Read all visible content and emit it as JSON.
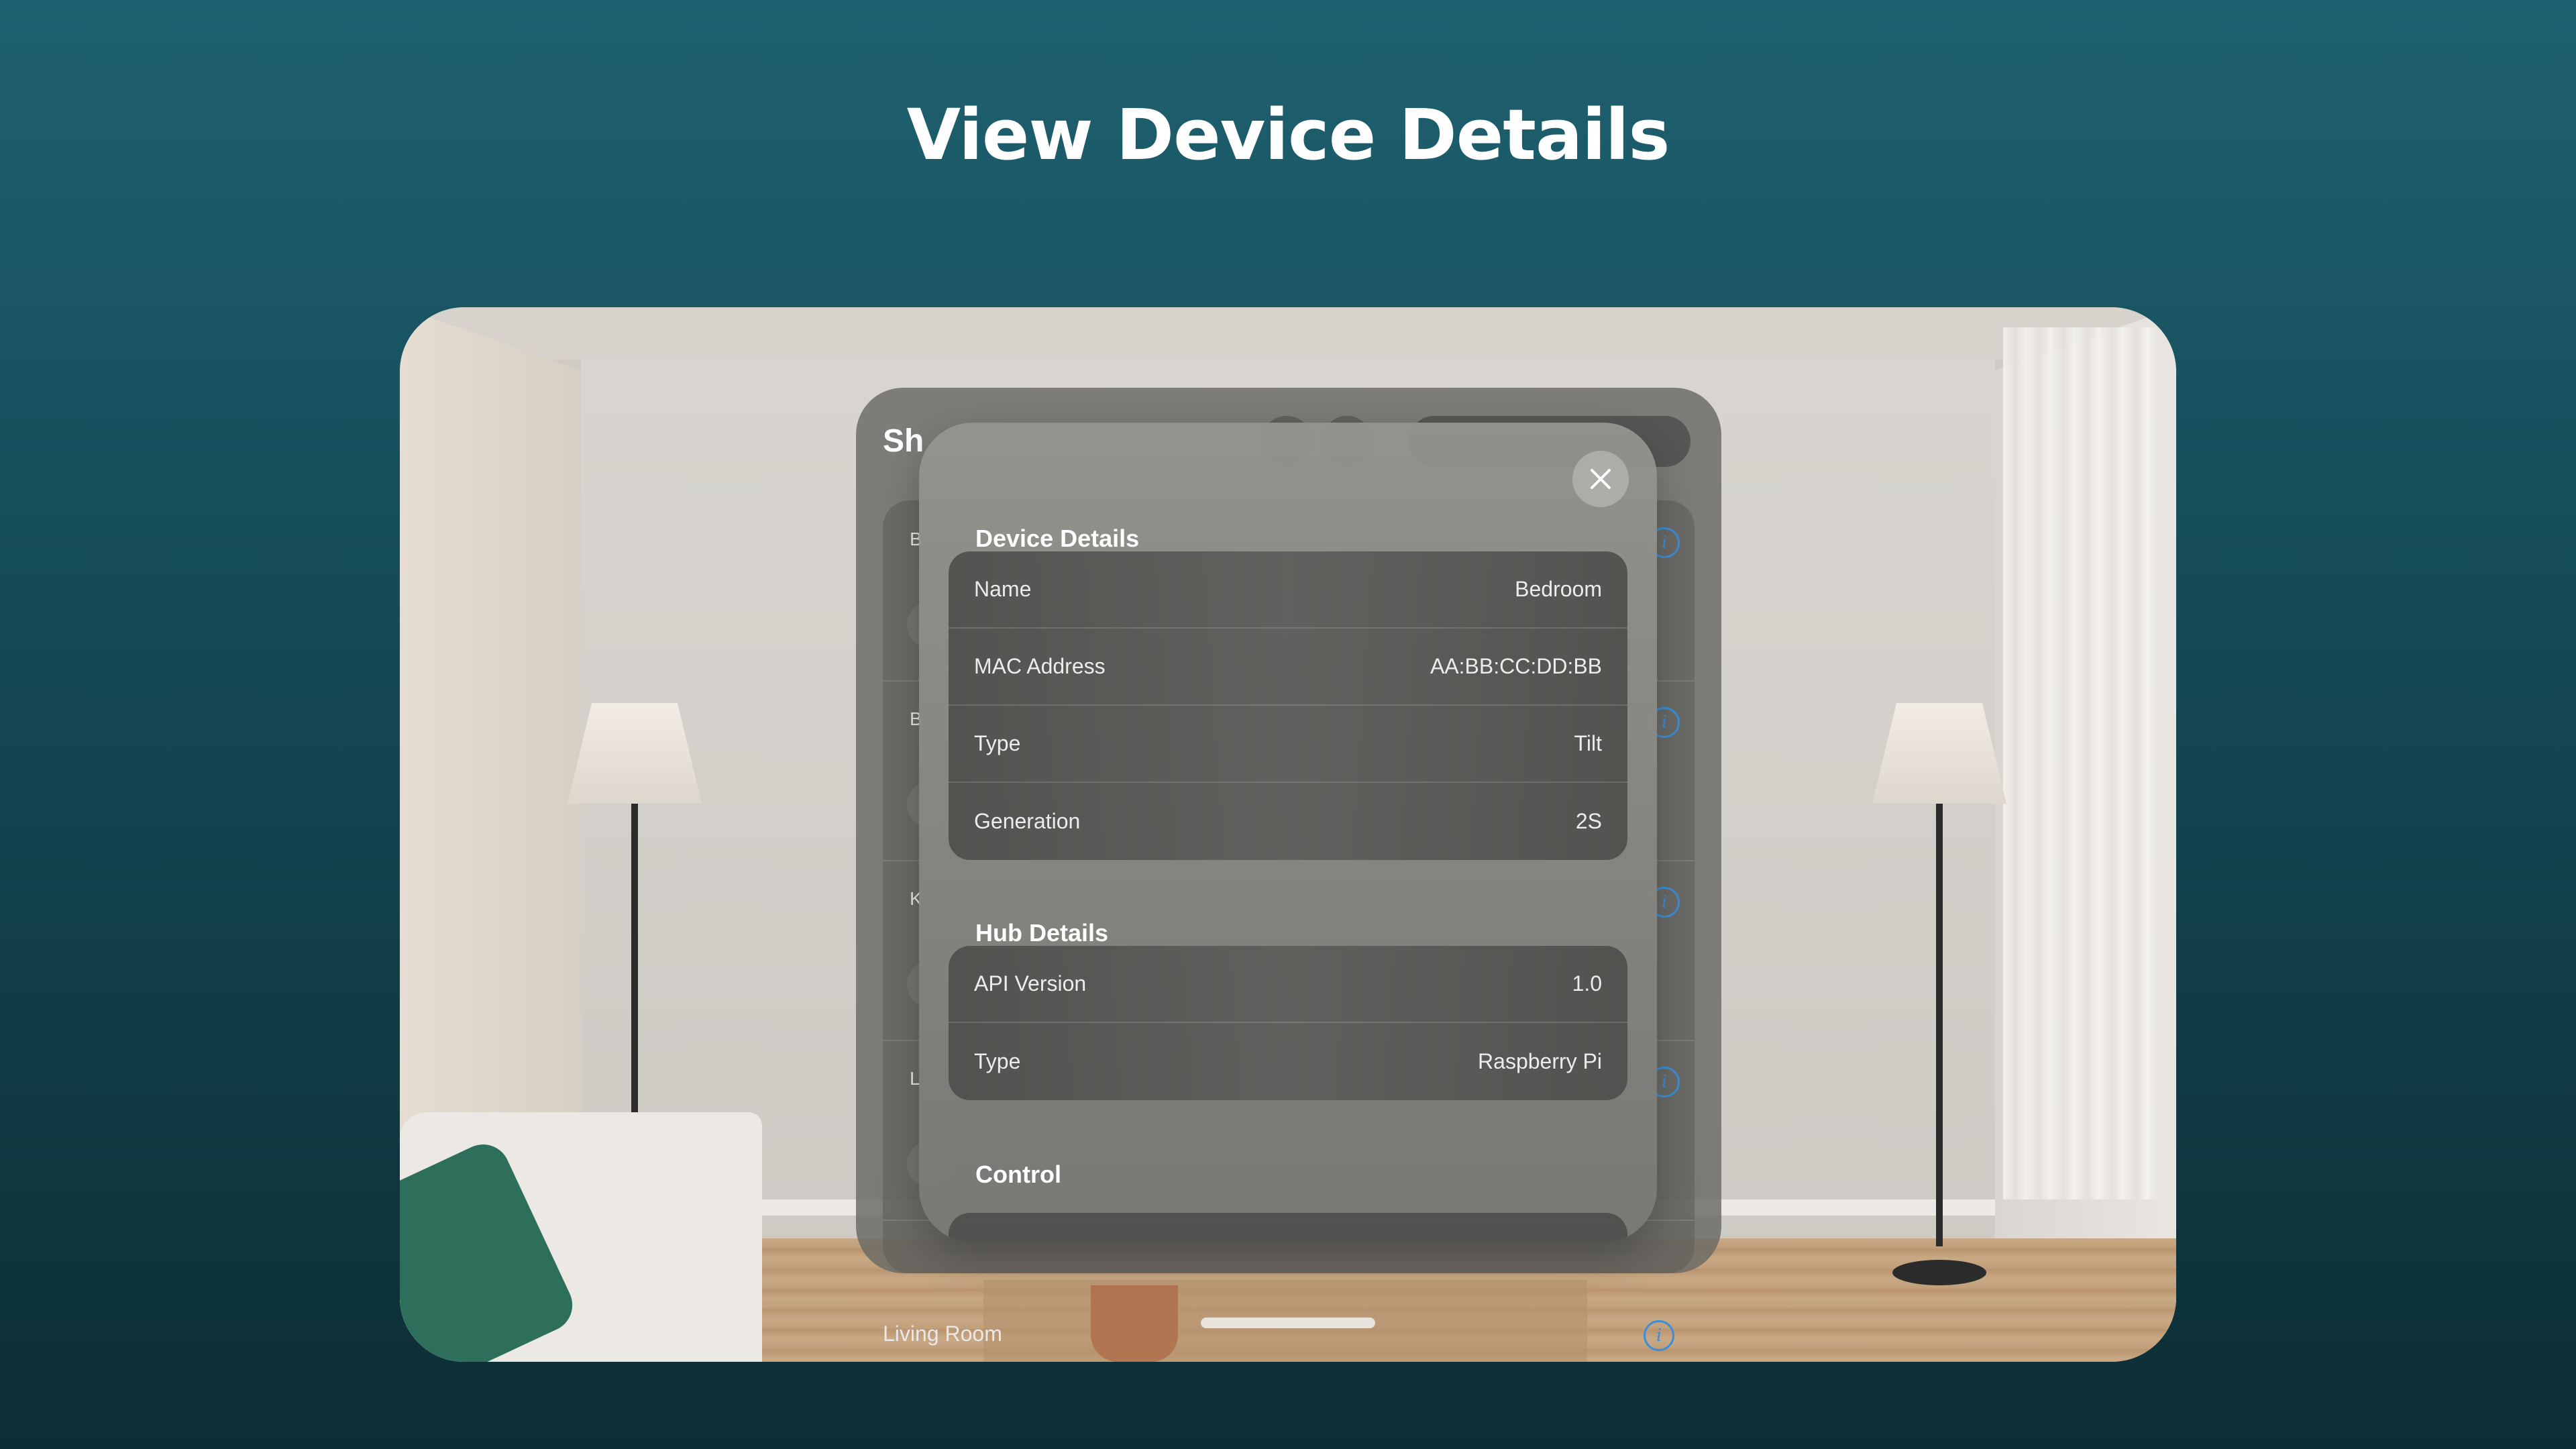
{
  "page": {
    "headline": "View Device Details"
  },
  "background_window": {
    "title": "Sh",
    "row_letters": [
      "B",
      "B",
      "K",
      "L"
    ],
    "bottom_label": "Living Room"
  },
  "modal": {
    "close_icon": "close-icon",
    "device_details": {
      "title": "Device Details",
      "rows": [
        {
          "label": "Name",
          "value": "Bedroom"
        },
        {
          "label": "MAC Address",
          "value": "AA:BB:CC:DD:BB"
        },
        {
          "label": "Type",
          "value": "Tilt"
        },
        {
          "label": "Generation",
          "value": "2S"
        }
      ]
    },
    "hub_details": {
      "title": "Hub Details",
      "rows": [
        {
          "label": "API Version",
          "value": "1.0"
        },
        {
          "label": "Type",
          "value": "Raspberry Pi"
        }
      ]
    },
    "control": {
      "title": "Control"
    }
  },
  "colors": {
    "background_top": "#1f6170",
    "background_bottom": "#0d2d35",
    "info_icon": "#3c8fd6"
  }
}
